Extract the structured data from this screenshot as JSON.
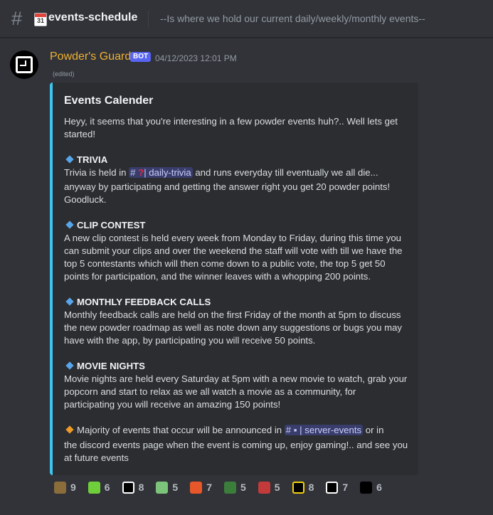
{
  "header": {
    "channel_name": "events-schedule",
    "calendar_day": "31",
    "topic": "--Is where we hold our current daily/weekly/monthly events--"
  },
  "message": {
    "author": "Powder's Guard",
    "badge": "BOT",
    "timestamp": "04/12/2023 12:01 PM",
    "edited": "(edited)"
  },
  "embed": {
    "title": "Events Calender",
    "intro_1": "Heyy, it seems that you're interesting in a few powder events huh?.. Well lets get",
    "intro_2": "started!",
    "trivia": {
      "heading": "TRIVIA",
      "before": "Trivia is held in",
      "mention": "daily-trivia",
      "after": "and runs everyday till eventually we all die...",
      "line2": "anyway by participating and getting the answer right you get 20 powder points!",
      "line3": "Goodluck."
    },
    "clip": {
      "heading": "CLIP CONTEST",
      "line1": "A new clip contest is held every week from Monday to Friday, during this time you",
      "line2": "can submit your clips and over the weekend the staff will vote with till we have the",
      "line3": "top 5 contestants which will then come down to a public vote, the top 5 get 50",
      "line4": "points for participation, and the winner leaves with a whopping 200 points."
    },
    "feedback": {
      "heading": "MONTHLY FEEDBACK CALLS",
      "line1": "Monthly feedback calls are held on the first Friday of the month at 5pm to discuss",
      "line2": "the new powder roadmap as well as note down any suggestions or bugs you may",
      "line3": "have with the app, by participating you will receive 50 points."
    },
    "movie": {
      "heading": "MOVIE NIGHTS",
      "line1": "Movie nights are held every Saturday at 5pm with a new movie to watch, grab your",
      "line2": "popcorn and start to relax as we all watch a movie as a community, for",
      "line3": "participating you will receive an amazing 150 points!"
    },
    "footer": {
      "before": "Majority of events that occur will be announced in",
      "mention": "server-events",
      "after": "or in",
      "line2": "the discord events page when the event is coming up, enjoy gaming!.. and see you",
      "line3": "at future events"
    }
  },
  "reactions": [
    {
      "icon": "trophy-wave-emoji-icon",
      "count": "9",
      "color": "#8a6d3b"
    },
    {
      "icon": "green-frog-emoji-icon",
      "count": "6",
      "color": "#6fcf3a"
    },
    {
      "icon": "powder-logo-white-emoji-icon",
      "count": "8",
      "color": "#ffffff"
    },
    {
      "icon": "pepe-fighter-emoji-icon",
      "count": "5",
      "color": "#7cc47a"
    },
    {
      "icon": "fire-emoji-icon",
      "count": "7",
      "color": "#e8572a"
    },
    {
      "icon": "pepe-blue-emoji-icon",
      "count": "5",
      "color": "#3b7d3a"
    },
    {
      "icon": "pepe-red-emoji-icon",
      "count": "5",
      "color": "#c23a3a"
    },
    {
      "icon": "powder-logo-yellow-emoji-icon",
      "count": "8",
      "color": "#f5d20b"
    },
    {
      "icon": "powder-logo-black-emoji-icon",
      "count": "7",
      "color": "#ffffff"
    },
    {
      "icon": "powder-logo-round-emoji-icon",
      "count": "6",
      "color": "#000000"
    }
  ]
}
